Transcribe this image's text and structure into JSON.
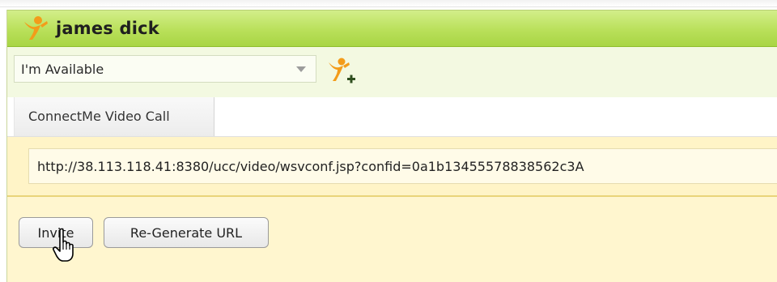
{
  "header": {
    "title": "james dick",
    "logo_icon": "connectme-person-icon"
  },
  "status": {
    "selected": "I'm Available",
    "add_contact_icon": "add-contact-icon"
  },
  "tabs": [
    {
      "label": "ConnectMe Video Call"
    }
  ],
  "video_call": {
    "url_value": "http://38.113.118.41:8380/ucc/video/wsvconf.jsp?confid=0a1b13455578838562c3A",
    "invite_label": "Invite",
    "regenerate_label": "Re-Generate URL"
  },
  "colors": {
    "brand_orange": "#f39c1a",
    "header_green": "#b9e05a",
    "panel_yellow": "#fff6cf"
  }
}
